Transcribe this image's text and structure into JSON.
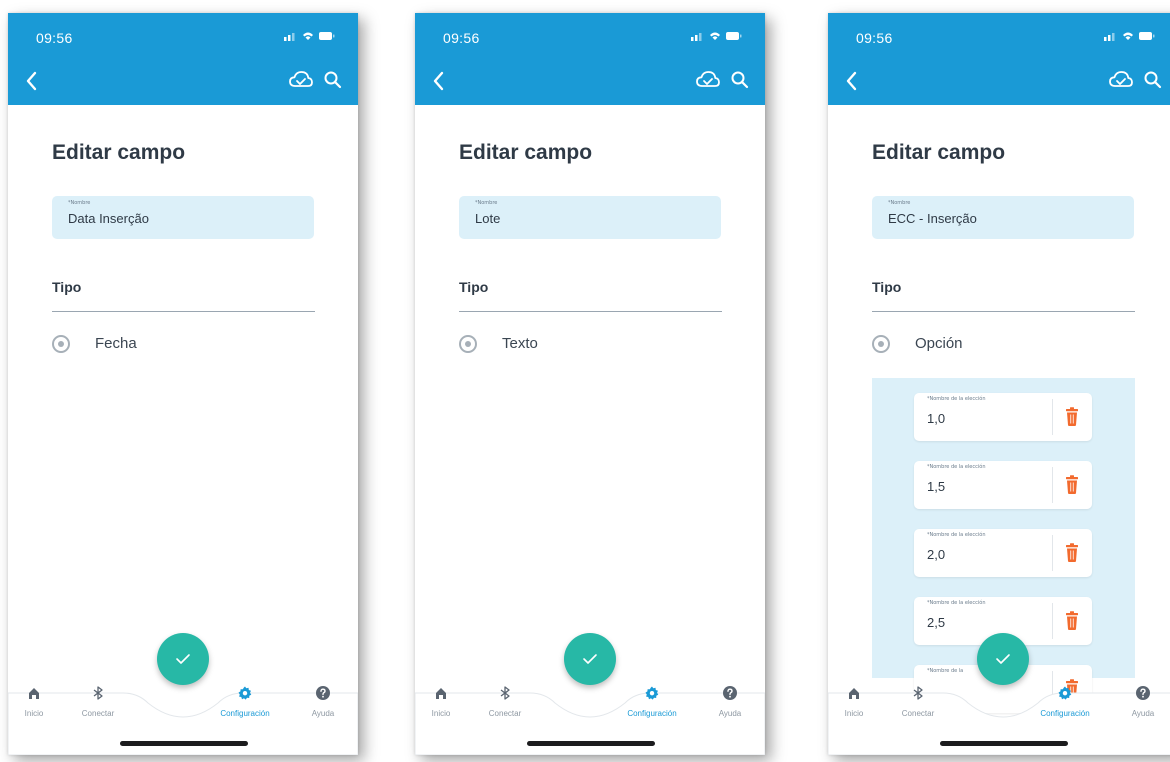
{
  "colors": {
    "brand_blue": "#1a9ad6",
    "field_bg": "#dcf0f9",
    "panel_bg": "#dcf0f9",
    "fab_teal": "#27b8a6",
    "trash_orange": "#f26a2e",
    "nav_grey": "#8e98a2"
  },
  "screens": [
    {
      "status": {
        "time": "09:56"
      },
      "title": "Editar campo",
      "name_field": {
        "caption": "*Nombre",
        "value": "Data Inserção"
      },
      "tipo_label": "Tipo",
      "type_option": "Fecha"
    },
    {
      "status": {
        "time": "09:56"
      },
      "title": "Editar campo",
      "name_field": {
        "caption": "*Nombre",
        "value": "Lote"
      },
      "tipo_label": "Tipo",
      "type_option": "Texto"
    },
    {
      "status": {
        "time": "09:56"
      },
      "title": "Editar campo",
      "name_field": {
        "caption": "*Nombre",
        "value": "ECC - Inserção"
      },
      "tipo_label": "Tipo",
      "type_option": "Opción",
      "choices": [
        {
          "caption": "*Nombre de la elección",
          "value": "1,0"
        },
        {
          "caption": "*Nombre de la elección",
          "value": "1,5"
        },
        {
          "caption": "*Nombre de la elección",
          "value": "2,0"
        },
        {
          "caption": "*Nombre de la elección",
          "value": "2,5"
        },
        {
          "caption": "*Nombre de la",
          "value": ""
        }
      ]
    }
  ],
  "nav": {
    "inicio": "Inicio",
    "conectar": "Conectar",
    "configuracion": "Configuración",
    "ayuda": "Ayuda"
  },
  "icons": {
    "back": "chevron-left-icon",
    "cloud": "cloud-sync-icon",
    "search": "search-icon",
    "fab": "check-icon",
    "trash": "trash-icon",
    "home": "home-icon",
    "bluetooth": "bluetooth-icon",
    "settings": "gear-icon",
    "help": "help-icon"
  }
}
